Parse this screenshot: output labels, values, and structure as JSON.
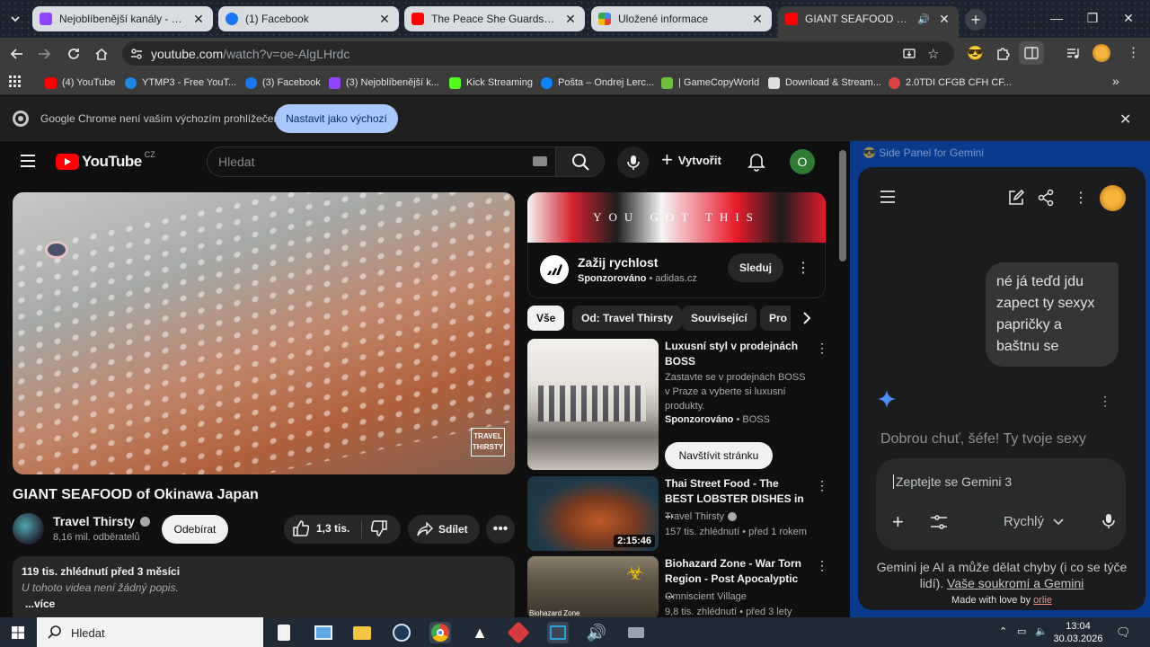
{
  "tabs": [
    {
      "title": "Nejoblíbenější kanály - Twitch",
      "color": "#9146ff"
    },
    {
      "title": "(1) Facebook",
      "color": "#1877f2"
    },
    {
      "title": "The Peace She Guards | Ambien",
      "color": "#ff0000"
    },
    {
      "title": "Uložené informace",
      "color": "#4285f4"
    },
    {
      "title": "GIANT SEAFOOD of Okinaw",
      "color": "#ff0000"
    }
  ],
  "omnibox": {
    "host": "youtube.com",
    "path": "/watch?v=oe-AlgLHrdc"
  },
  "bookmarks": [
    {
      "label": "(4) YouTube",
      "color": "#ff0000"
    },
    {
      "label": "YTMP3 - Free YouT...",
      "color": "#1e88e5"
    },
    {
      "label": "(3) Facebook",
      "color": "#1877f2"
    },
    {
      "label": "(3) Nejoblíbenější k...",
      "color": "#9146ff"
    },
    {
      "label": "Kick Streaming",
      "color": "#53fc18"
    },
    {
      "label": "Pošta – Ondrej Lerc...",
      "color": "#0a84ff"
    },
    {
      "label": "| GameCopyWorld",
      "color": "#6fbf3f"
    },
    {
      "label": "Download & Stream...",
      "color": "#dddddd"
    },
    {
      "label": "2.0TDI CFGB CFH CF...",
      "color": "#d44"
    }
  ],
  "infobar": {
    "message": "Google Chrome není vaším výchozím prohlížečem",
    "button": "Nastavit jako výchozí"
  },
  "youtube": {
    "logo": "YouTube",
    "country": "CZ",
    "search_placeholder": "Hledat",
    "create": "Vytvořit",
    "avatar_letter": "O",
    "watermark": "TRAVEL THIRSTY",
    "video_title": "GIANT SEAFOOD of Okinawa Japan",
    "channel": "Travel Thirsty",
    "subscribers": "8,16 mil. odběratelů",
    "subscribe": "Odebírat",
    "likes": "1,3 tis.",
    "share": "Sdílet",
    "desc_meta": "119 tis. zhlédnutí  před 3 měsíci",
    "desc_empty": "U tohoto videa není žádný popis.",
    "desc_more": "...více"
  },
  "ad": {
    "banner_text": "YOU GOT THIS",
    "title": "Zažij rychlost",
    "sponsored": "Sponzorováno",
    "domain": "adidas.cz",
    "follow": "Sleduj"
  },
  "chips": [
    "Vše",
    "Od: Travel Thirsty",
    "Související",
    "Pro"
  ],
  "recs": [
    {
      "title": "Luxusní styl v prodejnách BOSS",
      "desc": "Zastavte se v prodejnách BOSS v Praze a vyberte si luxusní produkty.",
      "sponsored": "Sponzorováno",
      "brand": "BOSS",
      "cta": "Navštívit stránku"
    },
    {
      "title": "Thai Street Food - The BEST LOBSTER DISHES in ...",
      "channel": "Travel Thirsty",
      "meta": "157 tis. zhlédnutí • před 1 rokem",
      "duration": "2:15:46"
    },
    {
      "title": "Biohazard Zone - War Torn Region - Post Apocalyptic ...",
      "channel": "Omniscient Village",
      "meta": "9,8 tis. zhlédnutí • před 3 lety",
      "thumb_label": "Biohazard Zone"
    }
  ],
  "gemini": {
    "panel_title": "Side Panel for Gemini",
    "user_message": "né já teďd jdu zapect ty sexyx papričky a baštnu se",
    "response_preview": "Dobrou chuť, šéfe! Ty tvoje sexy",
    "input_placeholder": "Zeptejte se Gemini 3",
    "mode": "Rychlý",
    "disclaimer": "Gemini je AI a může dělat chyby (i co se týče lidí).",
    "privacy_link": "Vaše soukromí a Gemini",
    "made_with": "Made with love by",
    "author": "orlie"
  },
  "taskbar": {
    "search": "Hledat",
    "time": "13:04",
    "date": "30.03.2026"
  }
}
